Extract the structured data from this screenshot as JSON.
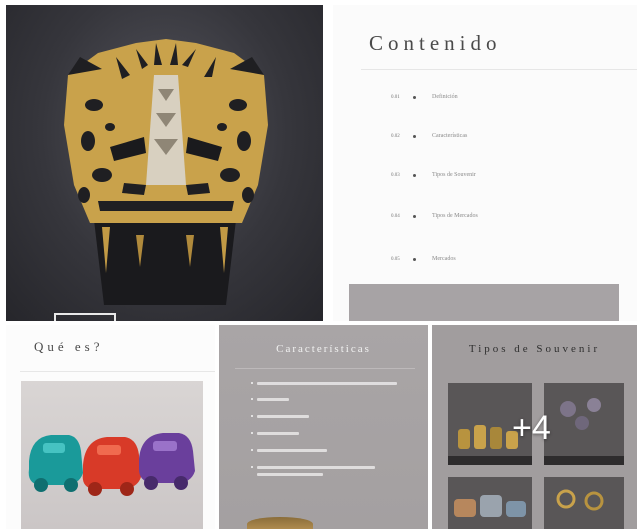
{
  "contents": {
    "title": "Contenido",
    "items": [
      {
        "num": "0.01",
        "label": "Definición"
      },
      {
        "num": "0.02",
        "label": "Características"
      },
      {
        "num": "0.03",
        "label": "Tipos de Souvenir"
      },
      {
        "num": "0.04",
        "label": "Tipos de Mercados"
      },
      {
        "num": "0.05",
        "label": "Mercados"
      }
    ]
  },
  "que_es": {
    "title": "Qué es?"
  },
  "caracteristicas": {
    "title": "Características",
    "bullet_count": 6
  },
  "tipos": {
    "title": "Tipos de Souvenir"
  },
  "gallery": {
    "more_badge": "+4"
  },
  "colors": {
    "hero_bg": "#36363c",
    "gold": "#c8a14a",
    "panel_gray": "#a5a1a2",
    "teal_car": "#1a9a9a",
    "red_car": "#d83a28",
    "purple_car": "#6a3f9c"
  }
}
